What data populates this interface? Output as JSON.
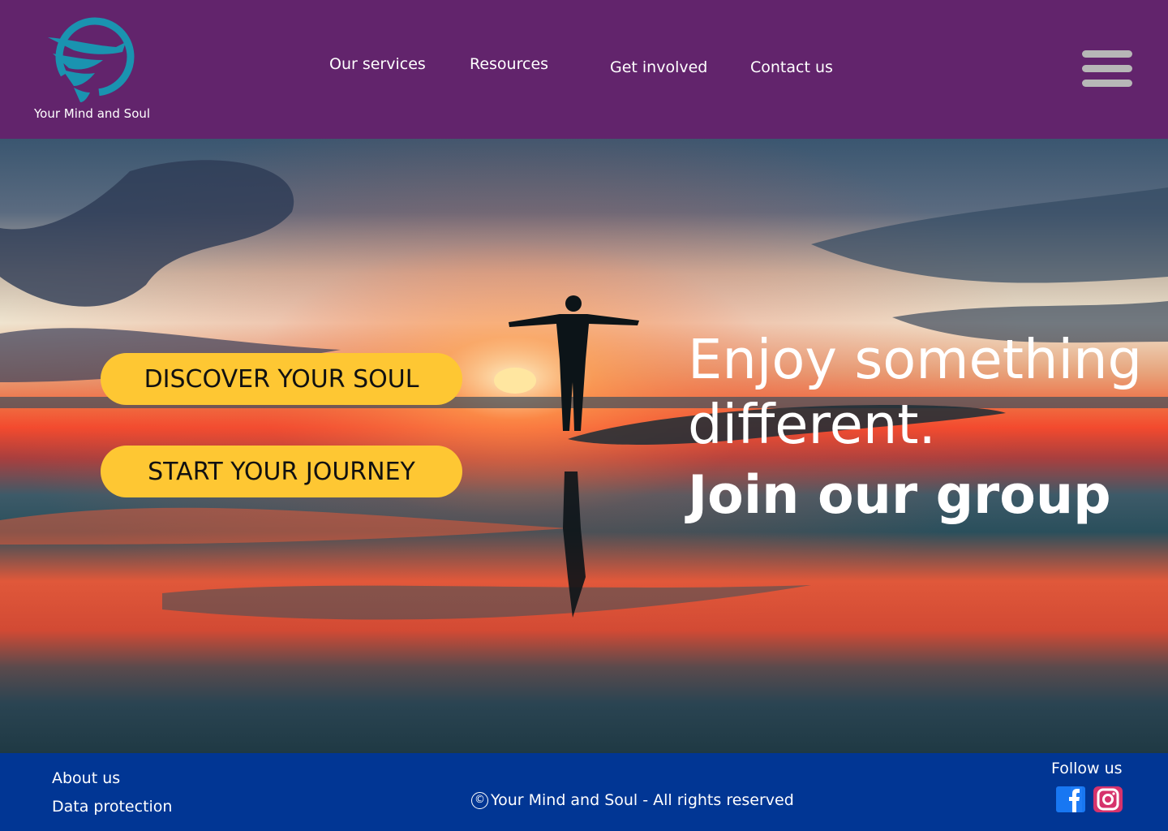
{
  "brand": {
    "name": "Your Mind and Soul",
    "logo_color": "#1a93b0"
  },
  "nav": {
    "items": [
      {
        "label": "Our services"
      },
      {
        "label": "Resources"
      },
      {
        "label": "Get involved"
      },
      {
        "label": "Contact us"
      }
    ],
    "menu_icon": "hamburger-icon"
  },
  "hero": {
    "buttons": [
      {
        "label": "DISCOVER YOUR SOUL"
      },
      {
        "label": "START YOUR JOURNEY"
      }
    ],
    "tagline_line1": "Enjoy something",
    "tagline_line2": "different.",
    "tagline_line3": "Join our group"
  },
  "footer": {
    "links": [
      {
        "label": "About us"
      },
      {
        "label": "Data protection"
      }
    ],
    "copyright_symbol": "©",
    "copyright_text": "Your Mind and Soul - All rights reserved",
    "follow_label": "Follow us",
    "social_icons": [
      "facebook-icon",
      "instagram-icon"
    ]
  },
  "colors": {
    "header_bg": "#62246c",
    "footer_bg": "#013694",
    "cta_bg": "#fec733",
    "menu_icon": "#b7b7b7"
  }
}
